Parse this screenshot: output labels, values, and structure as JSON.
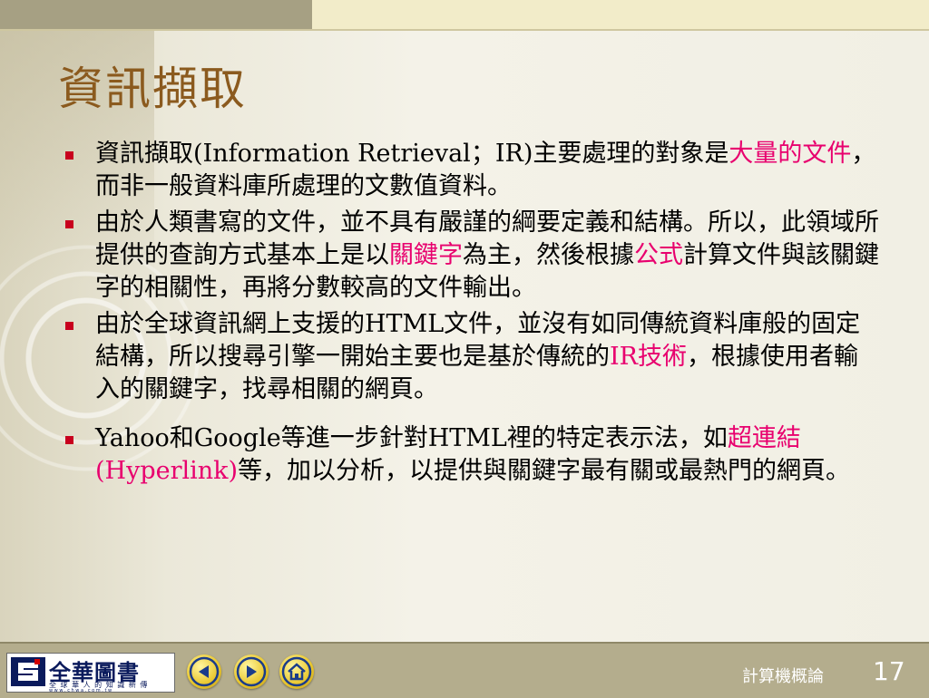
{
  "slide": {
    "title": "資訊擷取",
    "bullets": [
      {
        "parts": [
          {
            "text": "資訊擷取(Information  Retrieval；IR)主要處理的對象是",
            "highlight": false
          },
          {
            "text": "大量的文件",
            "highlight": true
          },
          {
            "text": "，而非一般資料庫所處理的文數值資料。",
            "highlight": false
          }
        ]
      },
      {
        "parts": [
          {
            "text": "由於人類書寫的文件，並不具有嚴謹的綱要定義和結構。所以，此領域所提供的查詢方式基本上是以",
            "highlight": false
          },
          {
            "text": "關鍵字",
            "highlight": true
          },
          {
            "text": "為主，然後根據",
            "highlight": false
          },
          {
            "text": "公式",
            "highlight": true
          },
          {
            "text": "計算文件與該關鍵字的相關性，再將分數較高的文件輸出。",
            "highlight": false
          }
        ]
      },
      {
        "parts": [
          {
            "text": "由於全球資訊網上支援的HTML文件，並沒有如同傳統資料庫般的固定結構，所以搜尋引擎一開始主要也是基於傳統的",
            "highlight": false
          },
          {
            "text": "IR技術",
            "highlight": true
          },
          {
            "text": "，根據使用者輸入的關鍵字，找尋相關的網頁。",
            "highlight": false
          }
        ]
      },
      {
        "parts": [
          {
            "text": "Yahoo和Google等進一步針對HTML裡的特定表示法，如",
            "highlight": false
          },
          {
            "text": "超連結(Hyperlink)",
            "highlight": true
          },
          {
            "text": "等，加以分析，以提供與關鍵字最有關或最熱門的網頁。",
            "highlight": false
          }
        ]
      }
    ]
  },
  "footer": {
    "publisher_logo_text": "全華圖書",
    "publisher_tagline": "全 球 華 人 的 知 識 新 傳",
    "publisher_url": "w w w . c h w a . c o m . t w",
    "course_name": "計算機概論",
    "page_number": "17",
    "nav_icons": [
      "back-arrow-icon",
      "forward-arrow-icon",
      "home-icon"
    ]
  },
  "colors": {
    "title": "#8b5a1e",
    "highlight": "#e8006e",
    "bullet": "#c8001e",
    "footer_bg": "#b4ad8d"
  }
}
